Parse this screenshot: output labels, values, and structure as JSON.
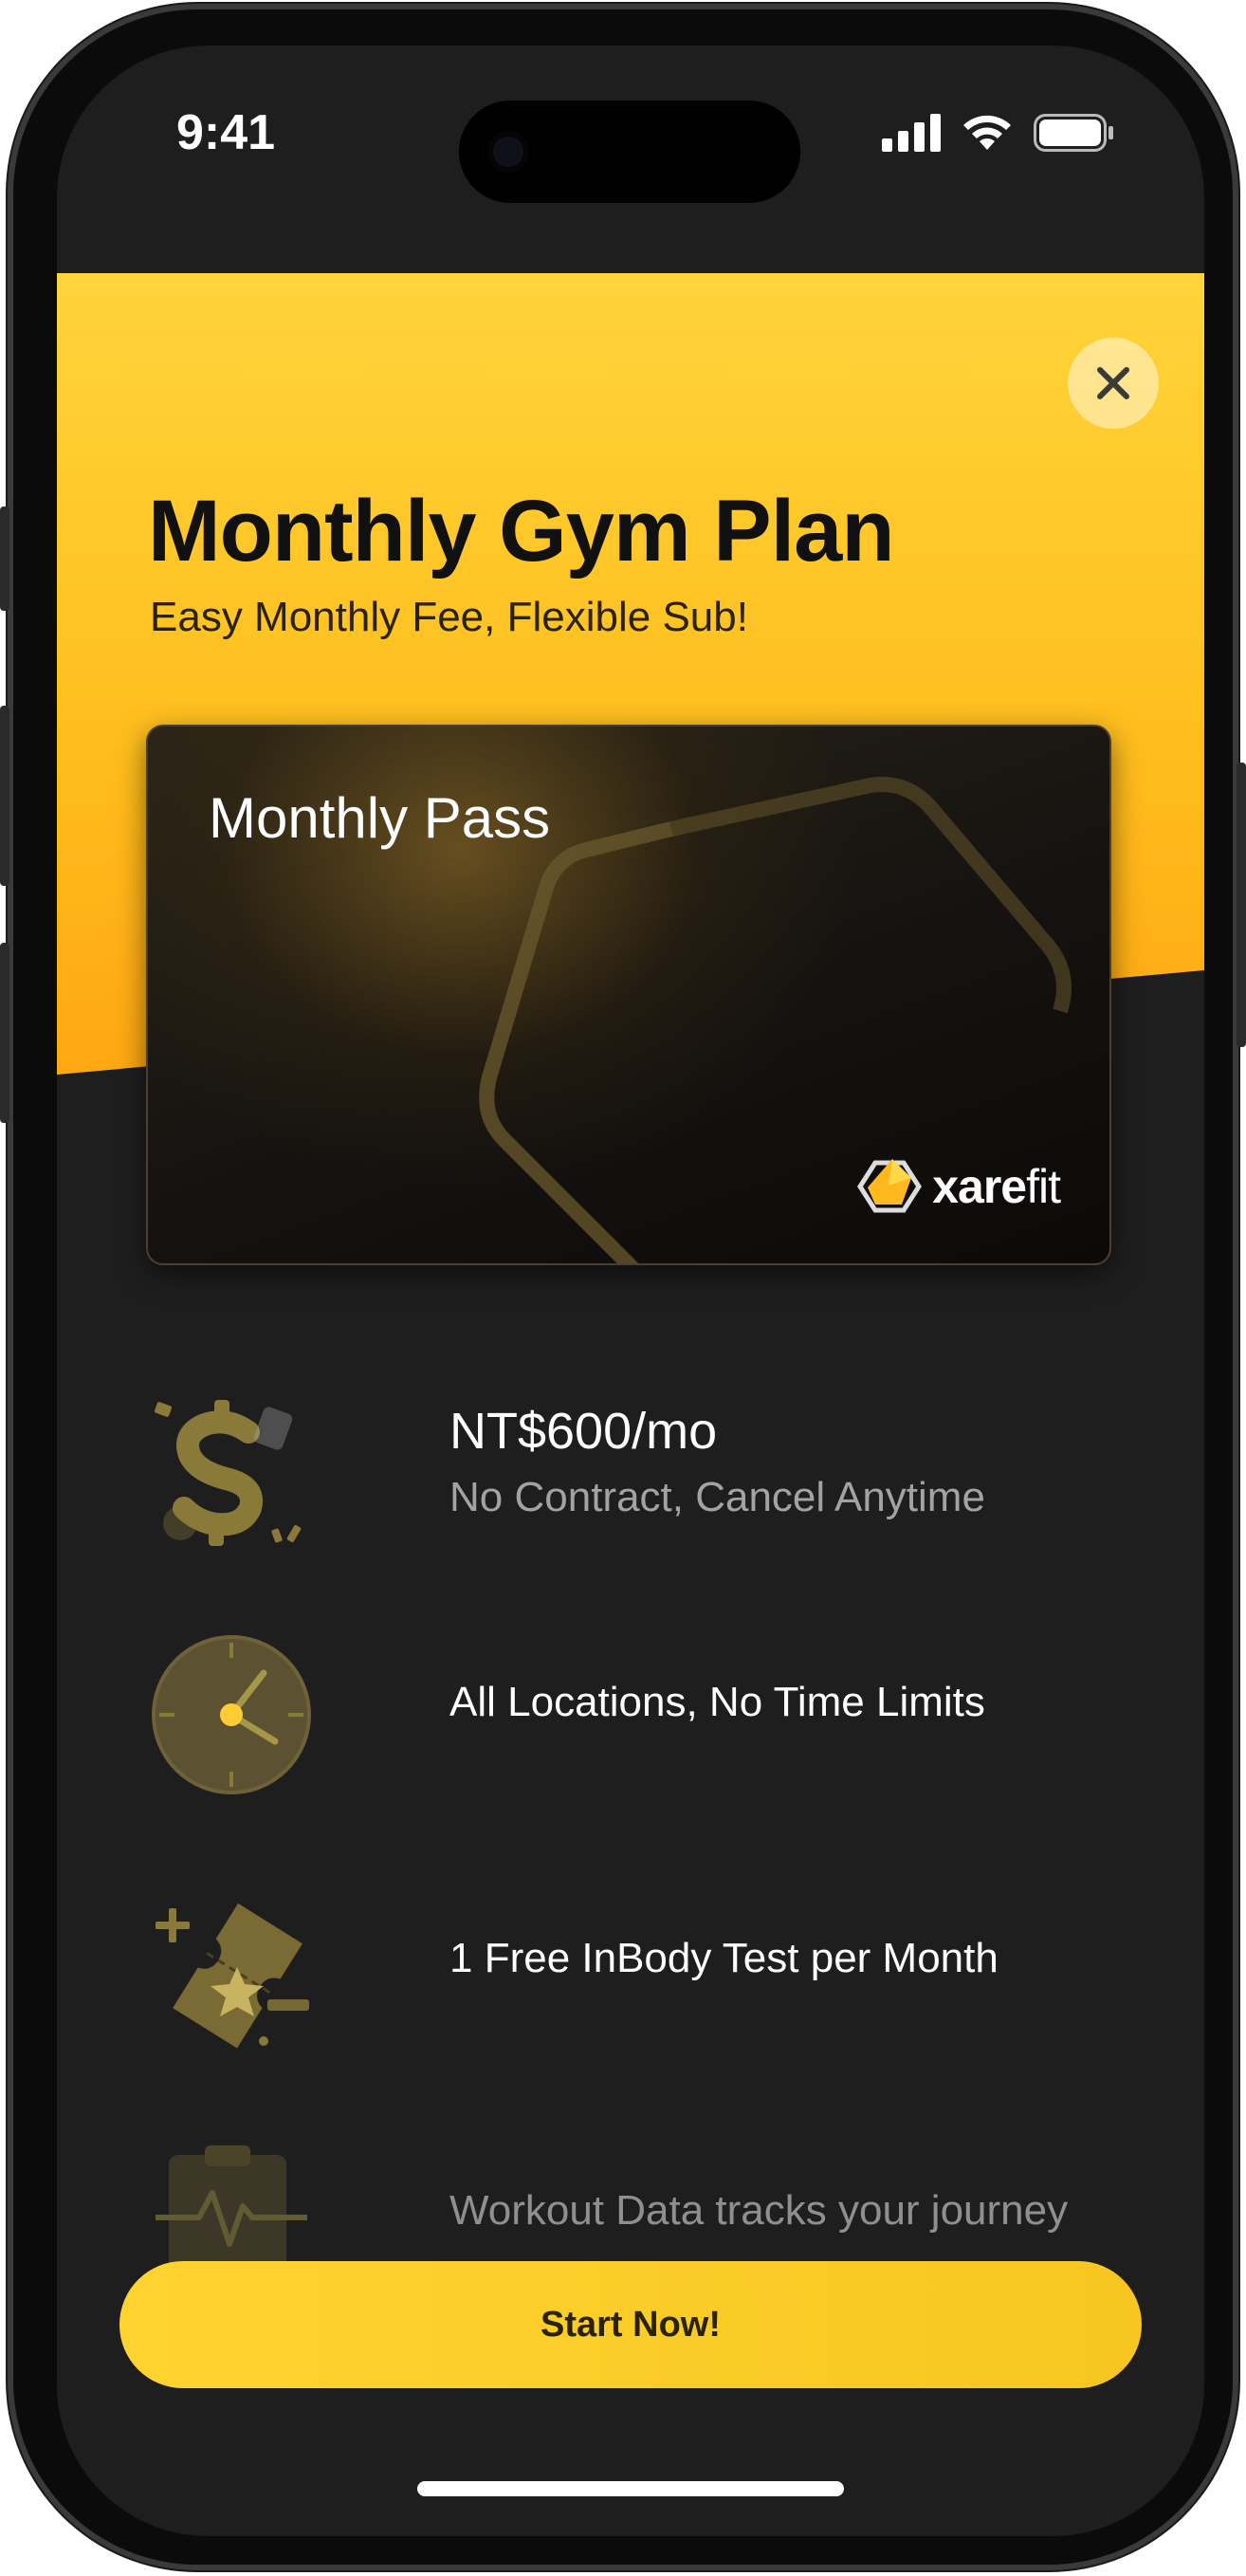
{
  "status_bar": {
    "time": "9:41"
  },
  "header": {
    "title": "Monthly Gym Plan",
    "subtitle": "Easy Monthly Fee, Flexible Sub!"
  },
  "card": {
    "title": "Monthly Pass",
    "brand": {
      "prefix": "xare",
      "suffix": "fit"
    }
  },
  "features": [
    {
      "icon": "dollar-icon",
      "title": "NT$600/mo",
      "subtitle": "No Contract, Cancel Anytime"
    },
    {
      "icon": "clock-icon",
      "title": "All Locations, No Time Limits"
    },
    {
      "icon": "ticket-icon",
      "title": "1 Free InBody Test per Month"
    },
    {
      "icon": "clipboard-pulse-icon",
      "title": "Workout Data tracks your journey"
    }
  ],
  "cta": {
    "label": "Start Now!"
  },
  "colors": {
    "accent": "#FFC825",
    "background": "#1E1E1E",
    "gold_icon": "#8A7A3A"
  }
}
